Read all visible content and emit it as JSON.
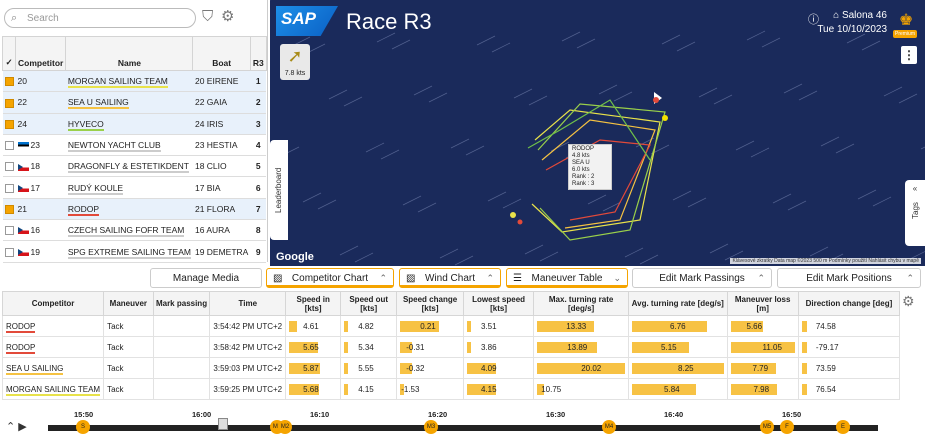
{
  "left_panel": {
    "search_placeholder": "Search",
    "headers": {
      "check": "✓",
      "competitor": "Competitor",
      "name": "Name",
      "boat": "Boat",
      "race": "R3"
    },
    "rows": [
      {
        "checked": true,
        "sail": "20",
        "flag": "",
        "name": "MORGAN SAILING TEAM",
        "color": "#e8e24a",
        "boat": "20 EIRENE",
        "rank": "1",
        "selected": true
      },
      {
        "checked": true,
        "sail": "22",
        "flag": "",
        "name": "SEA U SAILING",
        "color": "#f5c242",
        "boat": "22 GAIA",
        "rank": "2",
        "selected": true
      },
      {
        "checked": true,
        "sail": "24",
        "flag": "",
        "name": "HYVECO",
        "color": "#9ad04a",
        "boat": "24 IRIS",
        "rank": "3",
        "selected": true
      },
      {
        "checked": false,
        "sail": "23",
        "flag": "ee",
        "name": "NEWTON YACHT CLUB",
        "color": "#cccccc",
        "boat": "23 HESTIA",
        "rank": "4",
        "selected": false
      },
      {
        "checked": false,
        "sail": "18",
        "flag": "cz",
        "name": "DRAGONFLY & ESTETIKDENT",
        "color": "#cccccc",
        "boat": "18 CLIO",
        "rank": "5",
        "selected": false
      },
      {
        "checked": false,
        "sail": "17",
        "flag": "cz",
        "name": "RUDÝ KOULE",
        "color": "#cccccc",
        "boat": "17 BIA",
        "rank": "6",
        "selected": false
      },
      {
        "checked": true,
        "sail": "21",
        "flag": "",
        "name": "RODOP",
        "color": "#e24a3a",
        "boat": "21 FLORA",
        "rank": "7",
        "selected": true
      },
      {
        "checked": false,
        "sail": "16",
        "flag": "cz",
        "name": "CZECH SAILING FOFR TEAM",
        "color": "#cccccc",
        "boat": "16 AURA",
        "rank": "8",
        "selected": false
      },
      {
        "checked": false,
        "sail": "19",
        "flag": "cz",
        "name": "SPG EXTREME SAILING TEAM",
        "color": "#cccccc",
        "boat": "19 DEMETRA",
        "rank": "9",
        "selected": false
      }
    ]
  },
  "map": {
    "title": "Race R3",
    "location": "Salona 46",
    "date": "Tue 10/10/2023",
    "premium_label": "Premium",
    "wind_label": "7.8 kts",
    "leaderboard_tab": "Leaderboard",
    "tags_tab": "Tags",
    "attribution": "Google",
    "footer": "Klávesové zkratky  Data map ©2023  500 m  Podmínky použití  Nahlásit chybu v mapě",
    "boat_labels": [
      {
        "name": "RODOP",
        "speed": "4.8 kts",
        "rank": "Rank : 2"
      },
      {
        "name": "SEA U",
        "speed": "6.0 kts",
        "rank": "Rank : 3"
      }
    ]
  },
  "toolbar": {
    "manage_media": "Manage Media",
    "competitor_chart": "Competitor Chart",
    "wind_chart": "Wind Chart",
    "maneuver_table": "Maneuver Table",
    "edit_mark_passings": "Edit Mark Passings",
    "edit_mark_positions": "Edit Mark Positions"
  },
  "maneuvers": {
    "headers": [
      "Competitor",
      "Maneuver",
      "Mark passing",
      "Time",
      "Speed in [kts]",
      "Speed out [kts]",
      "Speed change [kts]",
      "Lowest speed [kts]",
      "Max. turning rate [deg/s]",
      "Avg. turning rate [deg/s]",
      "Maneuver loss [m]",
      "Direction change [deg]"
    ],
    "rows": [
      {
        "competitor": "RODOP",
        "color": "#e24a3a",
        "maneuver": "Tack",
        "mark": "",
        "time": "3:54:42 PM UTC+2",
        "speed_in": "4.61",
        "speed_out": "4.82",
        "speed_change": "0.21",
        "lowest": "3.51",
        "max_turn": "13.33",
        "avg_turn": "6.76",
        "loss": "5.66",
        "dir": "74.58"
      },
      {
        "competitor": "RODOP",
        "color": "#e24a3a",
        "maneuver": "Tack",
        "mark": "",
        "time": "3:58:42 PM UTC+2",
        "speed_in": "5.65",
        "speed_out": "5.34",
        "speed_change": "-0.31",
        "lowest": "3.86",
        "max_turn": "13.89",
        "avg_turn": "5.15",
        "loss": "11.05",
        "dir": "-79.17"
      },
      {
        "competitor": "SEA U SAILING",
        "color": "#f5c242",
        "maneuver": "Tack",
        "mark": "",
        "time": "3:59:03 PM UTC+2",
        "speed_in": "5.87",
        "speed_out": "5.55",
        "speed_change": "-0.32",
        "lowest": "4.09",
        "max_turn": "20.02",
        "avg_turn": "8.25",
        "loss": "7.79",
        "dir": "73.59"
      },
      {
        "competitor": "MORGAN SAILING TEAM",
        "color": "#e8e24a",
        "maneuver": "Tack",
        "mark": "",
        "time": "3:59:25 PM UTC+2",
        "speed_in": "5.68",
        "speed_out": "4.15",
        "speed_change": "-1.53",
        "lowest": "4.15",
        "max_turn": "10.75",
        "avg_turn": "5.84",
        "loss": "7.98",
        "dir": "76.54"
      }
    ],
    "bar_fraction": {
      "speed_in": [
        0.16,
        0.6,
        0.65,
        0.62
      ],
      "speed_out": [
        0.08,
        0.08,
        0.08,
        0.08
      ],
      "speed_change": [
        0.65,
        0.2,
        0.2,
        0.02
      ],
      "lowest": [
        0.05,
        0.05,
        0.45,
        0.45
      ],
      "max_turn": [
        0.65,
        0.68,
        1.0,
        0.08
      ],
      "avg_turn": [
        0.82,
        0.62,
        1.0,
        0.7
      ],
      "loss": [
        0.5,
        1.0,
        0.7,
        0.72
      ],
      "dir": [
        0.05,
        0.05,
        0.05,
        0.05
      ]
    }
  },
  "timeline": {
    "ticks": [
      "15:50",
      "16:00",
      "16:10",
      "16:20",
      "16:30",
      "16:40",
      "16:50"
    ],
    "marks": [
      "S",
      "M1",
      "M2",
      "M3",
      "M4",
      "M5",
      "F",
      "E"
    ]
  },
  "colors": {
    "accent": "#f5a400",
    "map_bg": "#1a2a5b",
    "sap_blue": "#1d8fe8"
  }
}
